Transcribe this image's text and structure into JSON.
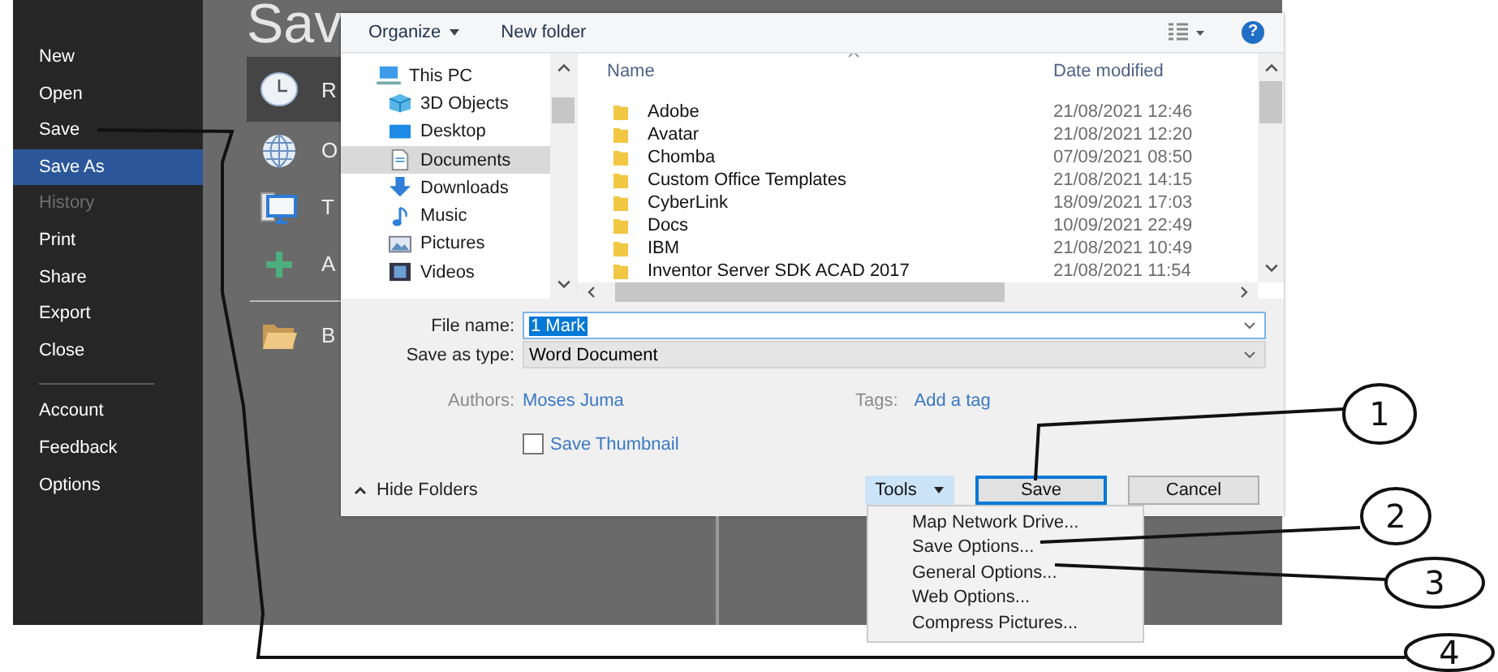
{
  "sidebar": {
    "items": [
      {
        "label": "New",
        "selected": false,
        "disabled": false
      },
      {
        "label": "Open",
        "selected": false,
        "disabled": false
      },
      {
        "label": "Save",
        "selected": false,
        "disabled": false
      },
      {
        "label": "Save As",
        "selected": true,
        "disabled": false
      },
      {
        "label": "History",
        "selected": false,
        "disabled": true
      },
      {
        "label": "Print",
        "selected": false,
        "disabled": false
      },
      {
        "label": "Share",
        "selected": false,
        "disabled": false
      },
      {
        "label": "Export",
        "selected": false,
        "disabled": false
      },
      {
        "label": "Close",
        "selected": false,
        "disabled": false
      }
    ],
    "footer_items": [
      {
        "label": "Account",
        "selected": false,
        "disabled": false
      },
      {
        "label": "Feedback",
        "selected": false,
        "disabled": false
      },
      {
        "label": "Options",
        "selected": false,
        "disabled": false
      }
    ]
  },
  "heading": "Sav",
  "places": [
    {
      "label": "R",
      "kind": "clock",
      "selected": true
    },
    {
      "label": "O",
      "kind": "globe",
      "selected": false
    },
    {
      "label": "T",
      "kind": "pc",
      "selected": false
    },
    {
      "label": "A",
      "kind": "plus",
      "selected": false
    },
    {
      "label": "B",
      "kind": "folder",
      "selected": false
    }
  ],
  "dialog": {
    "toolbar": {
      "organize": "Organize",
      "new_folder": "New folder",
      "help": "?"
    },
    "nav": [
      {
        "label": "This PC",
        "kind": "pc",
        "selected": false,
        "children": [
          {
            "label": "3D Objects",
            "kind": "cube",
            "selected": false
          },
          {
            "label": "Desktop",
            "kind": "desktop",
            "selected": false
          },
          {
            "label": "Documents",
            "kind": "document",
            "selected": true
          },
          {
            "label": "Downloads",
            "kind": "download",
            "selected": false
          },
          {
            "label": "Music",
            "kind": "music",
            "selected": false
          },
          {
            "label": "Pictures",
            "kind": "pictures",
            "selected": false
          },
          {
            "label": "Videos",
            "kind": "video",
            "selected": false
          }
        ]
      }
    ],
    "columns": [
      "Name",
      "Date modified"
    ],
    "rows": [
      {
        "name": "Adobe",
        "date": "21/08/2021 12:46"
      },
      {
        "name": "Avatar",
        "date": "21/08/2021 12:20"
      },
      {
        "name": "Chomba",
        "date": "07/09/2021 08:50"
      },
      {
        "name": "Custom Office Templates",
        "date": "21/08/2021 14:15"
      },
      {
        "name": "CyberLink",
        "date": "18/09/2021 17:03"
      },
      {
        "name": "Docs",
        "date": "10/09/2021 22:49"
      },
      {
        "name": "IBM",
        "date": "21/08/2021 10:49"
      },
      {
        "name": "Inventor Server SDK ACAD 2017",
        "date": "21/08/2021 11:54"
      }
    ],
    "file_name": {
      "label": "File name:",
      "value": "1 Mark"
    },
    "save_type": {
      "label": "Save as type:",
      "value": "Word Document"
    },
    "authors": {
      "label": "Authors:",
      "value": "Moses Juma"
    },
    "tags": {
      "label": "Tags:",
      "value": "Add a tag"
    },
    "thumbnail": {
      "label": "Save Thumbnail",
      "checked": false
    },
    "hide_folders": "Hide Folders",
    "tools": {
      "label": "Tools",
      "expanded": true,
      "items": [
        "Map Network Drive...",
        "Save Options...",
        "General Options...",
        "Web Options...",
        "Compress Pictures..."
      ]
    },
    "save": "Save",
    "cancel": "Cancel"
  },
  "annotations": [
    {
      "label": "1"
    },
    {
      "label": "2"
    },
    {
      "label": "3"
    },
    {
      "label": "4"
    }
  ]
}
